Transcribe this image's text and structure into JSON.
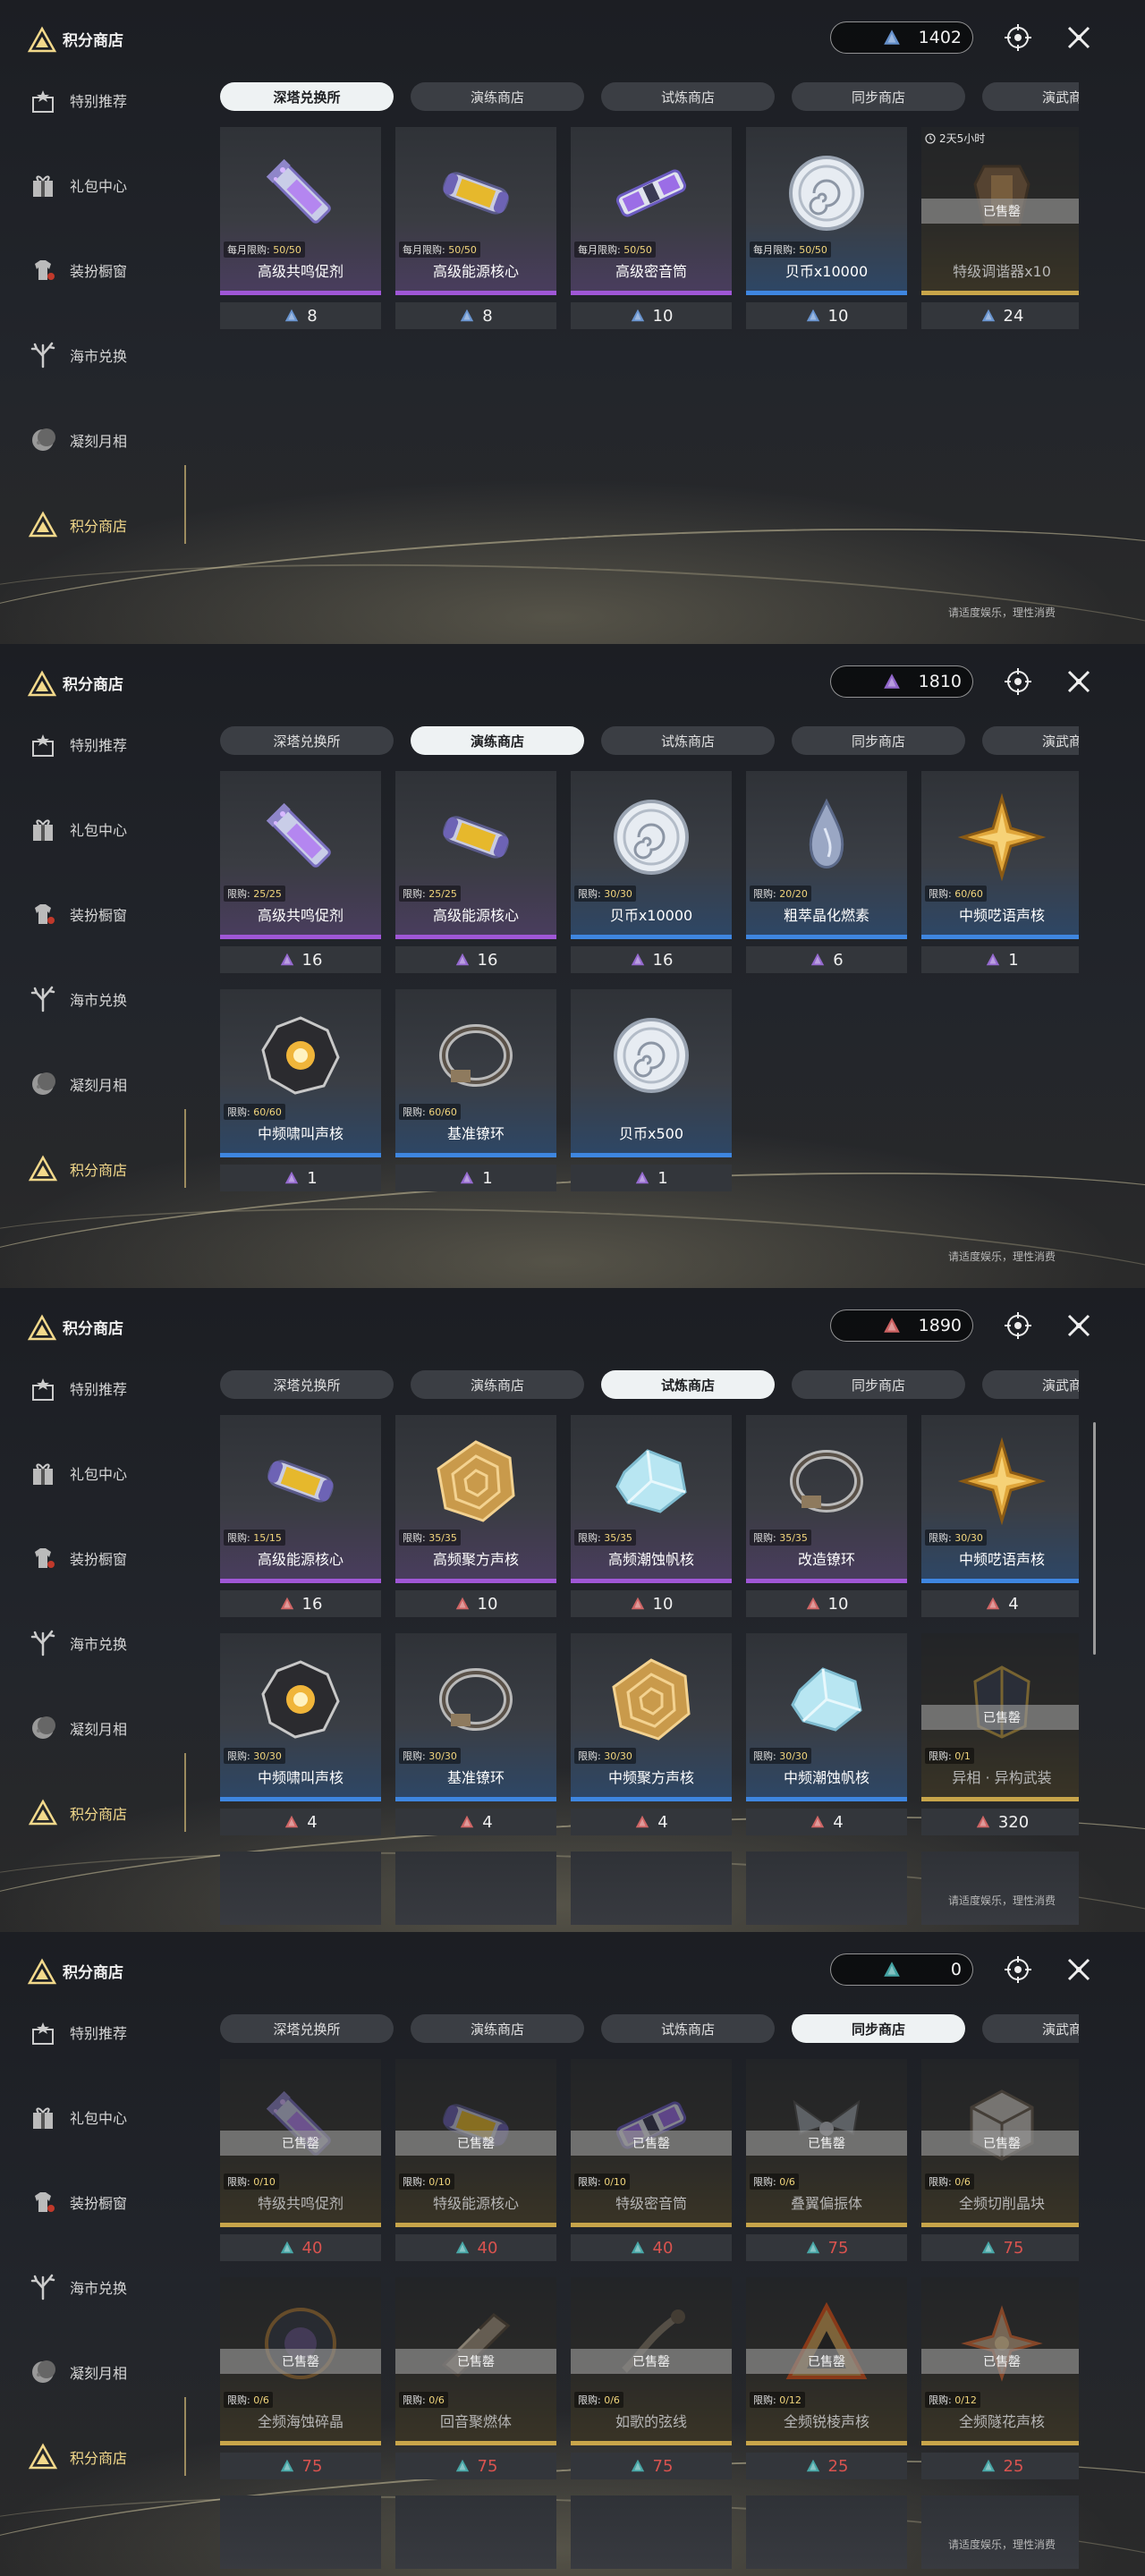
{
  "colors": {
    "accent_gold": "#f3d98b",
    "rarity_purple": "#9f57d6",
    "rarity_blue": "#3e86e0",
    "rarity_gold": "#c8a54a",
    "price_red": "#d9534f"
  },
  "sidebar": {
    "title": "积分商店",
    "items": [
      {
        "label": "特别推荐",
        "icon": "gift-star-icon"
      },
      {
        "label": "礼包中心",
        "icon": "gift-box-icon"
      },
      {
        "label": "装扮橱窗",
        "icon": "outfit-icon"
      },
      {
        "label": "海市兑换",
        "icon": "coral-icon"
      },
      {
        "label": "凝刻月相",
        "icon": "moon-icon"
      },
      {
        "label": "积分商店",
        "icon": "triangle-shop-icon"
      }
    ]
  },
  "footer_note": "请适度娱乐，理性消费",
  "tab_labels": [
    "深塔兑换所",
    "演练商店",
    "试炼商店",
    "同步商店",
    "演武商店"
  ],
  "panels": [
    {
      "currency": "1402",
      "currency_color": "#6f9ee0",
      "active_tab": 0,
      "items": [
        {
          "name": "高级共鸣促剂",
          "limit_label": "每月限购:",
          "limit": "50/50",
          "price": "8",
          "rarity": "purple",
          "icon": "vial-icon"
        },
        {
          "name": "高级能源核心",
          "limit_label": "每月限购:",
          "limit": "50/50",
          "price": "8",
          "rarity": "purple",
          "icon": "energy-core-icon"
        },
        {
          "name": "高级密音筒",
          "limit_label": "每月限购:",
          "limit": "50/50",
          "price": "10",
          "rarity": "purple",
          "icon": "sealed-tube-icon"
        },
        {
          "name": "贝币x10000",
          "limit_label": "每月限购:",
          "limit": "50/50",
          "price": "10",
          "rarity": "blue",
          "icon": "shell-coin-icon"
        },
        {
          "name": "特级调谐器x10",
          "limit_label": "",
          "limit": "",
          "price": "24",
          "rarity": "gold",
          "icon": "tuner-icon",
          "sold": "已售罄",
          "timer": "2天5小时"
        }
      ]
    },
    {
      "currency": "1810",
      "currency_color": "#a070e0",
      "active_tab": 1,
      "items": [
        {
          "name": "高级共鸣促剂",
          "limit_label": "限购:",
          "limit": "25/25",
          "price": "16",
          "rarity": "purple",
          "icon": "vial-icon"
        },
        {
          "name": "高级能源核心",
          "limit_label": "限购:",
          "limit": "25/25",
          "price": "16",
          "rarity": "purple",
          "icon": "energy-core-icon"
        },
        {
          "name": "贝币x10000",
          "limit_label": "限购:",
          "limit": "30/30",
          "price": "16",
          "rarity": "blue",
          "icon": "shell-coin-icon"
        },
        {
          "name": "粗萃晶化燃素",
          "limit_label": "限购:",
          "limit": "20/20",
          "price": "6",
          "rarity": "blue",
          "icon": "crystal-drop-icon"
        },
        {
          "name": "中频呓语声核",
          "limit_label": "限购:",
          "limit": "60/60",
          "price": "1",
          "rarity": "blue",
          "icon": "star-core-icon"
        },
        {
          "name": "中频啸叫声核",
          "limit_label": "限购:",
          "limit": "60/60",
          "price": "1",
          "rarity": "blue",
          "icon": "orb-core-icon"
        },
        {
          "name": "基准镣环",
          "limit_label": "限购:",
          "limit": "60/60",
          "price": "1",
          "rarity": "blue",
          "icon": "ring-icon"
        },
        {
          "name": "贝币x500",
          "limit_label": "",
          "limit": "",
          "price": "1",
          "rarity": "blue",
          "icon": "shell-coin-icon"
        }
      ]
    },
    {
      "currency": "1890",
      "currency_color": "#e06a6a",
      "active_tab": 2,
      "items": [
        {
          "name": "高级能源核心",
          "limit_label": "限购:",
          "limit": "15/15",
          "price": "16",
          "rarity": "purple",
          "icon": "energy-core-icon"
        },
        {
          "name": "高频聚方声核",
          "limit_label": "限购:",
          "limit": "35/35",
          "price": "10",
          "rarity": "purple",
          "icon": "gold-polygon-icon"
        },
        {
          "name": "高频潮蚀帆核",
          "limit_label": "限购:",
          "limit": "35/35",
          "price": "10",
          "rarity": "purple",
          "icon": "ice-shard-icon"
        },
        {
          "name": "改造镣环",
          "limit_label": "限购:",
          "limit": "35/35",
          "price": "10",
          "rarity": "purple",
          "icon": "ring-icon"
        },
        {
          "name": "中频呓语声核",
          "limit_label": "限购:",
          "limit": "30/30",
          "price": "4",
          "rarity": "blue",
          "icon": "star-core-icon"
        },
        {
          "name": "中频啸叫声核",
          "limit_label": "限购:",
          "limit": "30/30",
          "price": "4",
          "rarity": "blue",
          "icon": "orb-core-icon"
        },
        {
          "name": "基准镣环",
          "limit_label": "限购:",
          "limit": "30/30",
          "price": "4",
          "rarity": "blue",
          "icon": "ring-icon"
        },
        {
          "name": "中频聚方声核",
          "limit_label": "限购:",
          "limit": "30/30",
          "price": "4",
          "rarity": "blue",
          "icon": "gold-polygon-icon"
        },
        {
          "name": "中频潮蚀帆核",
          "limit_label": "限购:",
          "limit": "30/30",
          "price": "4",
          "rarity": "blue",
          "icon": "ice-shard-icon"
        },
        {
          "name": "异相 · 异构武装",
          "limit_label": "限购:",
          "limit": "0/1",
          "price": "320",
          "rarity": "gold",
          "icon": "armor-icon",
          "sold": "已售罄"
        }
      ]
    },
    {
      "currency": "0",
      "currency_color": "#49b3b3",
      "active_tab": 3,
      "items": [
        {
          "name": "特级共鸣促剂",
          "limit_label": "限购:",
          "limit": "0/10",
          "price": "40",
          "rarity": "gold",
          "icon": "vial-icon",
          "sold": "已售罄",
          "red": true
        },
        {
          "name": "特级能源核心",
          "limit_label": "限购:",
          "limit": "0/10",
          "price": "40",
          "rarity": "gold",
          "icon": "energy-core-icon",
          "sold": "已售罄",
          "red": true
        },
        {
          "name": "特级密音筒",
          "limit_label": "限购:",
          "limit": "0/10",
          "price": "40",
          "rarity": "gold",
          "icon": "sealed-tube-icon",
          "sold": "已售罄",
          "red": true
        },
        {
          "name": "叠翼偏振体",
          "limit_label": "限购:",
          "limit": "0/6",
          "price": "75",
          "rarity": "gold",
          "icon": "wing-icon",
          "sold": "已售罄",
          "red": true
        },
        {
          "name": "全频切削晶块",
          "limit_label": "限购:",
          "limit": "0/6",
          "price": "75",
          "rarity": "gold",
          "icon": "cube-icon",
          "sold": "已售罄",
          "red": true
        },
        {
          "name": "全频海蚀碎晶",
          "limit_label": "限购:",
          "limit": "0/6",
          "price": "75",
          "rarity": "gold",
          "icon": "disc-icon",
          "sold": "已售罄",
          "red": true
        },
        {
          "name": "回音聚燃体",
          "limit_label": "限购:",
          "limit": "0/6",
          "price": "75",
          "rarity": "gold",
          "icon": "blade-icon",
          "sold": "已售罄",
          "red": true
        },
        {
          "name": "如歌的弦线",
          "limit_label": "限购:",
          "limit": "0/6",
          "price": "75",
          "rarity": "gold",
          "icon": "string-icon",
          "sold": "已售罄",
          "red": true
        },
        {
          "name": "全频锐棱声核",
          "limit_label": "限购:",
          "limit": "0/12",
          "price": "25",
          "rarity": "gold",
          "icon": "edge-core-icon",
          "sold": "已售罄",
          "red": true
        },
        {
          "name": "全频隧花声核",
          "limit_label": "限购:",
          "limit": "0/12",
          "price": "25",
          "rarity": "gold",
          "icon": "flower-core-icon",
          "sold": "已售罄",
          "red": true
        }
      ]
    }
  ]
}
